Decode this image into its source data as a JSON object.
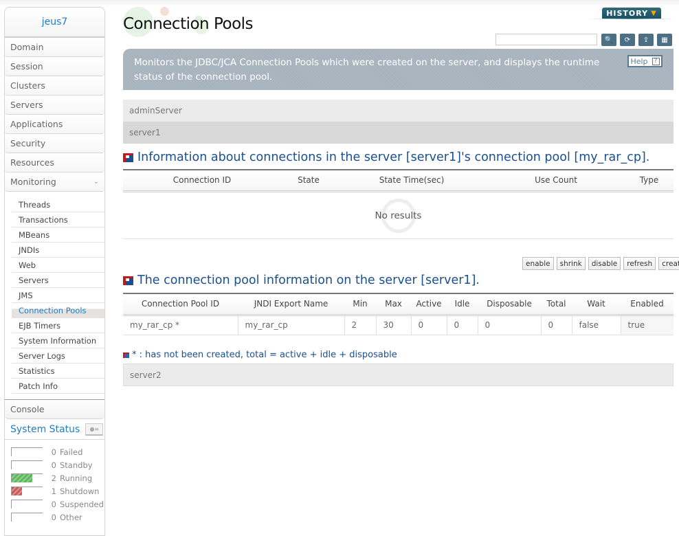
{
  "sidebar": {
    "domain_name": "jeus7",
    "menu": [
      {
        "label": "Domain"
      },
      {
        "label": "Session"
      },
      {
        "label": "Clusters"
      },
      {
        "label": "Servers"
      },
      {
        "label": "Applications"
      },
      {
        "label": "Security"
      },
      {
        "label": "Resources"
      },
      {
        "label": "Monitoring"
      }
    ],
    "monitoring_items": [
      {
        "label": "Threads"
      },
      {
        "label": "Transactions"
      },
      {
        "label": "MBeans"
      },
      {
        "label": "JNDIs"
      },
      {
        "label": "Web"
      },
      {
        "label": "Servers"
      },
      {
        "label": "JMS"
      },
      {
        "label": "Connection Pools",
        "active": true
      },
      {
        "label": "EJB Timers"
      },
      {
        "label": "System Information"
      },
      {
        "label": "Server Logs"
      },
      {
        "label": "Statistics"
      },
      {
        "label": "Patch Info"
      }
    ],
    "console_label": "Console",
    "system_status": {
      "title": "System Status",
      "rows": [
        {
          "count": "0",
          "label": "Failed",
          "fill": 0,
          "color": ""
        },
        {
          "count": "0",
          "label": "Standby",
          "fill": 0,
          "color": ""
        },
        {
          "count": "2",
          "label": "Running",
          "fill": 0.67,
          "color": "green"
        },
        {
          "count": "1",
          "label": "Shutdown",
          "fill": 0.33,
          "color": "red"
        },
        {
          "count": "0",
          "label": "Suspended",
          "fill": 0,
          "color": ""
        },
        {
          "count": "0",
          "label": "Other",
          "fill": 0,
          "color": ""
        }
      ]
    }
  },
  "header": {
    "title": "Connection Pools",
    "history_label": "HISTORY",
    "search_value": "",
    "description": "Monitors the JDBC/JCA Connection Pools which were created on the server, and displays the runtime status of the connection pool.",
    "help_label": "Help",
    "help_icon": "?"
  },
  "servers": {
    "admin": "adminServer",
    "server1": "server1",
    "server2": "server2"
  },
  "connections_section": {
    "title": "Information about connections in the server [server1]'s connection pool [my_rar_cp].",
    "columns": [
      "Connection ID",
      "State",
      "State Time(sec)",
      "Use Count",
      "Type"
    ],
    "empty_text": "No results"
  },
  "actions": [
    "enable",
    "shrink",
    "disable",
    "refresh",
    "create"
  ],
  "pool_section": {
    "title": "The connection pool information on the server [server1].",
    "columns": [
      "Connection Pool ID",
      "JNDI Export Name",
      "Min",
      "Max",
      "Active",
      "Idle",
      "Disposable",
      "Total",
      "Wait",
      "Enabled"
    ],
    "rows": [
      [
        "my_rar_cp *",
        "my_rar_cp",
        "2",
        "30",
        "0",
        "0",
        "0",
        "0",
        "false",
        "true"
      ]
    ],
    "note": "* : has not been created, total = active + idle + disposable"
  }
}
